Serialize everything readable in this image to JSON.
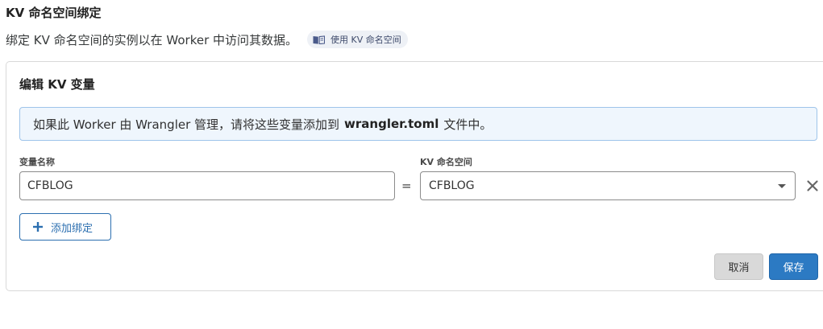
{
  "header": {
    "title": "KV 命名空间绑定",
    "description": "绑定 KV 命名空间的实例以在 Worker 中访问其数据。",
    "doc_link_label": "使用 KV 命名空间",
    "doc_icon": "book-icon"
  },
  "card": {
    "title": "编辑 KV 变量",
    "banner": {
      "prefix": "如果此 Worker 由 Wrangler 管理，请将这些变量添加到",
      "filename": "wrangler.toml",
      "suffix": "文件中。"
    },
    "binding": {
      "variable_label": "变量名称",
      "variable_value": "CFBLOG",
      "equals": "=",
      "namespace_label": "KV 命名空间",
      "namespace_value": "CFBLOG"
    },
    "add_binding_label": "添加绑定",
    "cancel_label": "取消",
    "save_label": "保存"
  },
  "colors": {
    "accent": "#2c7ac3",
    "banner_bg": "#eff6fd",
    "banner_border": "#9ec4ea"
  }
}
